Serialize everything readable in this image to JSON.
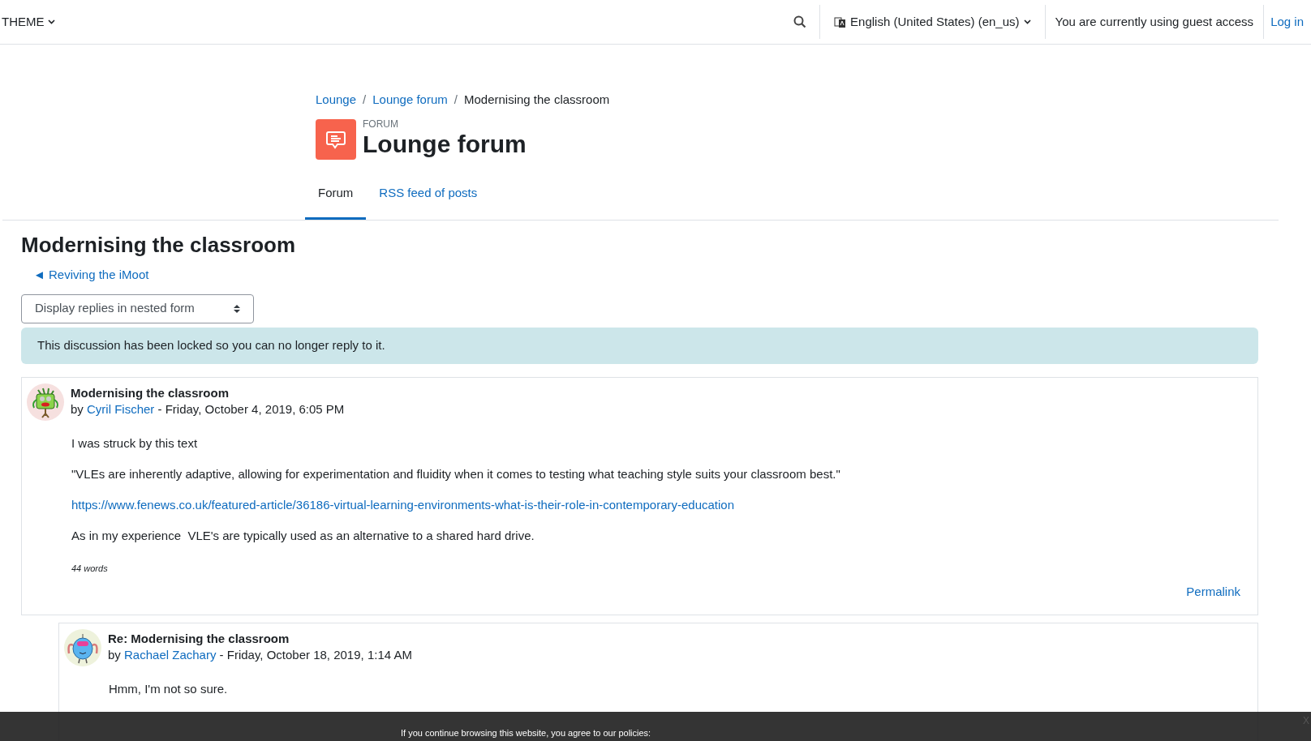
{
  "navbar": {
    "theme_menu": "THEME",
    "language": "English (United States) (en_us)",
    "guest_notice": "You are currently using guest access",
    "login": "Log in"
  },
  "breadcrumb": [
    {
      "label": "Lounge",
      "link": true
    },
    {
      "separator": "/"
    },
    {
      "label": "Lounge forum",
      "link": true
    },
    {
      "separator": "/"
    },
    {
      "label": "Modernising the classroom",
      "link": false
    }
  ],
  "header": {
    "kicker": "FORUM",
    "title": "Lounge forum"
  },
  "tabs": [
    {
      "label": "Forum",
      "selected": true
    },
    {
      "label": "RSS feed of posts",
      "selected": false
    }
  ],
  "discussion": {
    "title": "Modernising the classroom",
    "back_link": "◄ Reviving the iMoot",
    "display_mode": "Display replies in nested form",
    "notice": "This discussion has been locked so you can no longer reply to it."
  },
  "posts": [
    {
      "subject": "Modernising the classroom",
      "by": "by",
      "author": "Cyril Fischer",
      "date": " - Friday, October 4, 2019, 6:05 PM",
      "reply": false,
      "paragraphs": [
        {
          "kind": "text",
          "text": "I was struck by this text"
        },
        {
          "kind": "text",
          "text": "\"VLEs are inherently adaptive, allowing for experimentation and fluidity when it comes to testing what teaching style suits your classroom best.\""
        },
        {
          "kind": "link",
          "text": "https://www.fenews.co.uk/featured-article/36186-virtual-learning-environments-what-is-their-role-in-contemporary-education"
        },
        {
          "kind": "text",
          "text": "As in my experience  VLE's are typically used as an alternative to a shared hard drive."
        }
      ],
      "word_count": "44 words",
      "actions": [
        "Permalink"
      ]
    },
    {
      "subject": "Re: Modernising the classroom",
      "by": "by",
      "author": "Rachael Zachary",
      "date": " - Friday, October 18, 2019, 1:14 AM",
      "reply": true,
      "paragraphs": [
        {
          "kind": "text",
          "text": "Hmm, I'm not so sure."
        }
      ]
    }
  ],
  "cookie_bar": {
    "text": "If you continue browsing this website, you agree to our policies:",
    "close": "X"
  }
}
